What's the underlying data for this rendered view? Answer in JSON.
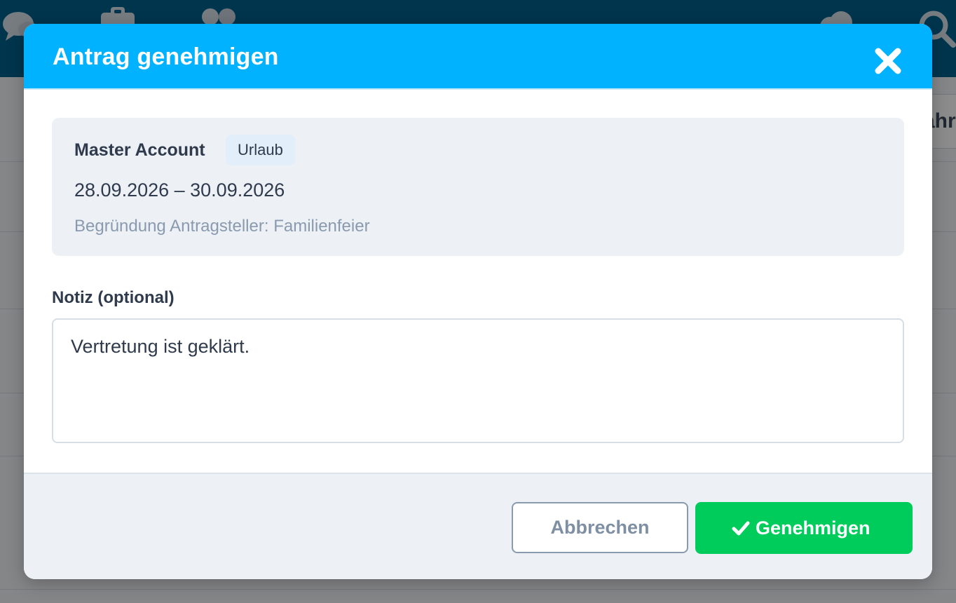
{
  "background": {
    "icons": [
      "chat-icon",
      "clipboard-icon",
      "users-icon",
      "cloud-icon",
      "search-icon"
    ],
    "partial_tab_label": "ahr"
  },
  "modal": {
    "title": "Antrag genehmigen",
    "close_icon": "close-icon",
    "request": {
      "account_name": "Master Account",
      "type_badge": "Urlaub",
      "date_range": "28.09.2026 – 30.09.2026",
      "reason": "Begründung Antragsteller: Familienfeier"
    },
    "note": {
      "label": "Notiz (optional)",
      "value": "Vertretung ist geklärt."
    },
    "footer": {
      "cancel_label": "Abbrechen",
      "approve_label": "Genehmigen",
      "approve_icon": "check-icon"
    }
  },
  "colors": {
    "header": "#00b2ff",
    "topbar": "#00628f",
    "approve": "#00cc5c",
    "info_box": "#edf1f6"
  }
}
